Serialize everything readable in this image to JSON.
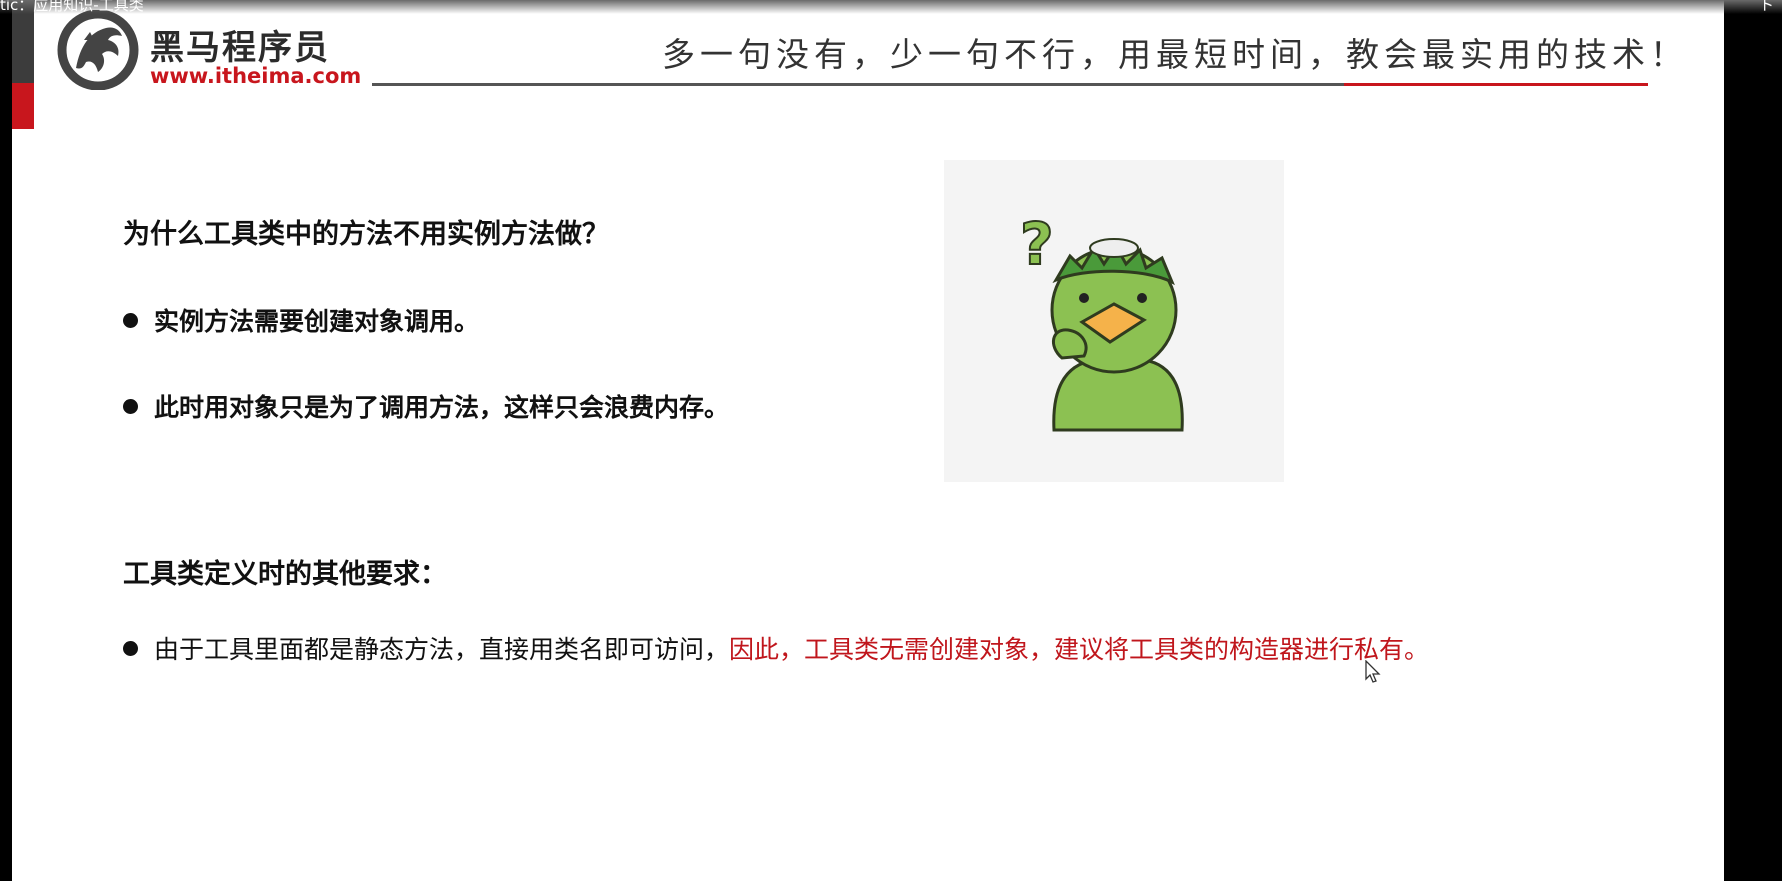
{
  "window": {
    "title": "tic：应用知识-工具类",
    "corner_mark": "ト"
  },
  "logo": {
    "name_cn": "黑马程序员",
    "url": "www.itheima.com"
  },
  "slogan": "多一句没有，少一句不行，用最短时间，教会最实用的技术！",
  "section1": {
    "heading": "为什么工具类中的方法不用实例方法做？",
    "bullets": [
      "实例方法需要创建对象调用。",
      "此时用对象只是为了调用方法，这样只会浪费内存。"
    ]
  },
  "section2": {
    "heading": "工具类定义时的其他要求：",
    "bullet_plain": "由于工具里面都是静态方法，直接用类名即可访问，",
    "bullet_red": "因此，工具类无需创建对象，建议将工具类的构造器进行私有。"
  },
  "illustration": {
    "icon": "thinking-kappa-icon",
    "mark": "?"
  },
  "colors": {
    "accent_red": "#c0161c",
    "text": "#111111",
    "header_line": "#555555"
  }
}
